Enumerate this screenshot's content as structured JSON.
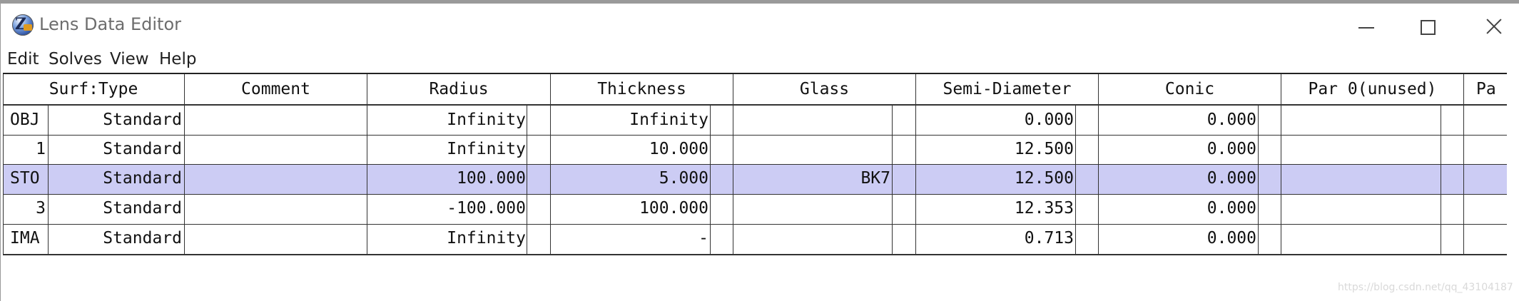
{
  "window": {
    "title": "Lens Data Editor",
    "icon": "zemax-app-icon"
  },
  "menu": [
    "Edit",
    "Solves",
    "View",
    "Help"
  ],
  "columns": [
    "Surf:Type",
    "Comment",
    "Radius",
    "Thickness",
    "Glass",
    "Semi-Diameter",
    "Conic",
    "Par 0(unused)",
    "Pa"
  ],
  "rows": [
    {
      "surf": "OBJ",
      "type": "Standard",
      "comment": "",
      "radius": "Infinity",
      "thickness": "Infinity",
      "glass": "",
      "semi_diameter": "0.000",
      "conic": "0.000",
      "par0": ""
    },
    {
      "surf": "1",
      "type": "Standard",
      "comment": "",
      "radius": "Infinity",
      "thickness": "10.000",
      "glass": "",
      "semi_diameter": "12.500",
      "conic": "0.000",
      "par0": ""
    },
    {
      "surf": "STO",
      "type": "Standard",
      "comment": "",
      "radius": "100.000",
      "thickness": "5.000",
      "glass": "BK7",
      "semi_diameter": "12.500",
      "conic": "0.000",
      "par0": "",
      "selected": true
    },
    {
      "surf": "3",
      "type": "Standard",
      "comment": "",
      "radius": "-100.000",
      "thickness": "100.000",
      "glass": "",
      "semi_diameter": "12.353",
      "conic": "0.000",
      "par0": ""
    },
    {
      "surf": "IMA",
      "type": "Standard",
      "comment": "",
      "radius": "Infinity",
      "thickness": "-",
      "glass": "",
      "semi_diameter": "0.713",
      "conic": "0.000",
      "par0": ""
    }
  ],
  "colors": {
    "selected_row": "#ccccf4",
    "grid_line": "#333333",
    "watermark": "#d9d9d9"
  },
  "watermark": "https://blog.csdn.net/qq_43104187"
}
